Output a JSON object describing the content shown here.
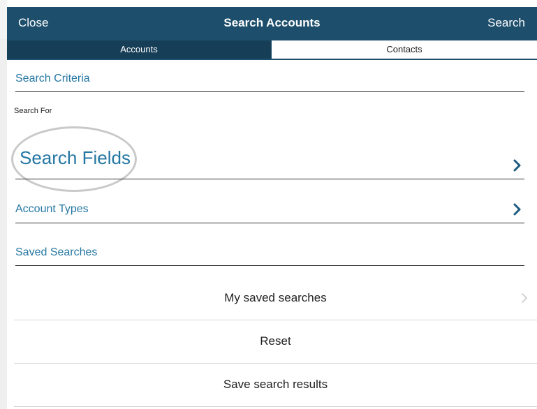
{
  "navbar": {
    "close_label": "Close",
    "title": "Search Accounts",
    "search_label": "Search"
  },
  "tabs": [
    {
      "label": "Accounts",
      "selected": false
    },
    {
      "label": "Contacts",
      "selected": true
    }
  ],
  "criteria": {
    "title": "Search Criteria",
    "search_for_label": "Search For",
    "search_fields_label": "Search Fields",
    "account_types_label": "Account Types"
  },
  "saved": {
    "title": "Saved Searches",
    "my_saved_label": "My saved searches",
    "reset_label": "Reset",
    "save_results_label": "Save search results"
  },
  "colors": {
    "navbar": "#1d4f6c",
    "accent": "#2577a3",
    "chevron": "#1e5b80"
  },
  "icons": {
    "link_chevron": "chevron-right-icon",
    "row_chevron": "chevron-right-icon"
  }
}
